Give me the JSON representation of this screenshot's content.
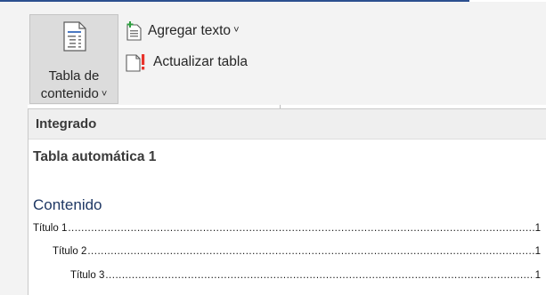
{
  "ribbon": {
    "toc_button": {
      "line1": "Tabla de",
      "line2": "contenido",
      "icon": "table-of-contents-icon"
    },
    "add_text": {
      "label": "Agregar texto",
      "icon": "add-text-icon"
    },
    "update_table": {
      "label": "Actualizar tabla",
      "icon": "update-table-icon"
    }
  },
  "gallery": {
    "section_header": "Integrado",
    "item_title": "Tabla automática 1",
    "preview": {
      "heading": "Contenido",
      "entries": [
        {
          "title": "Título 1",
          "page": "1"
        },
        {
          "title": "Título 2",
          "page": "1"
        },
        {
          "title": "Título 3",
          "page": "1"
        }
      ]
    }
  },
  "colors": {
    "accent": "#2b4f8f",
    "heading_blue": "#1f3864",
    "warning_red": "#e8332b",
    "add_green": "#2e9e3f"
  }
}
